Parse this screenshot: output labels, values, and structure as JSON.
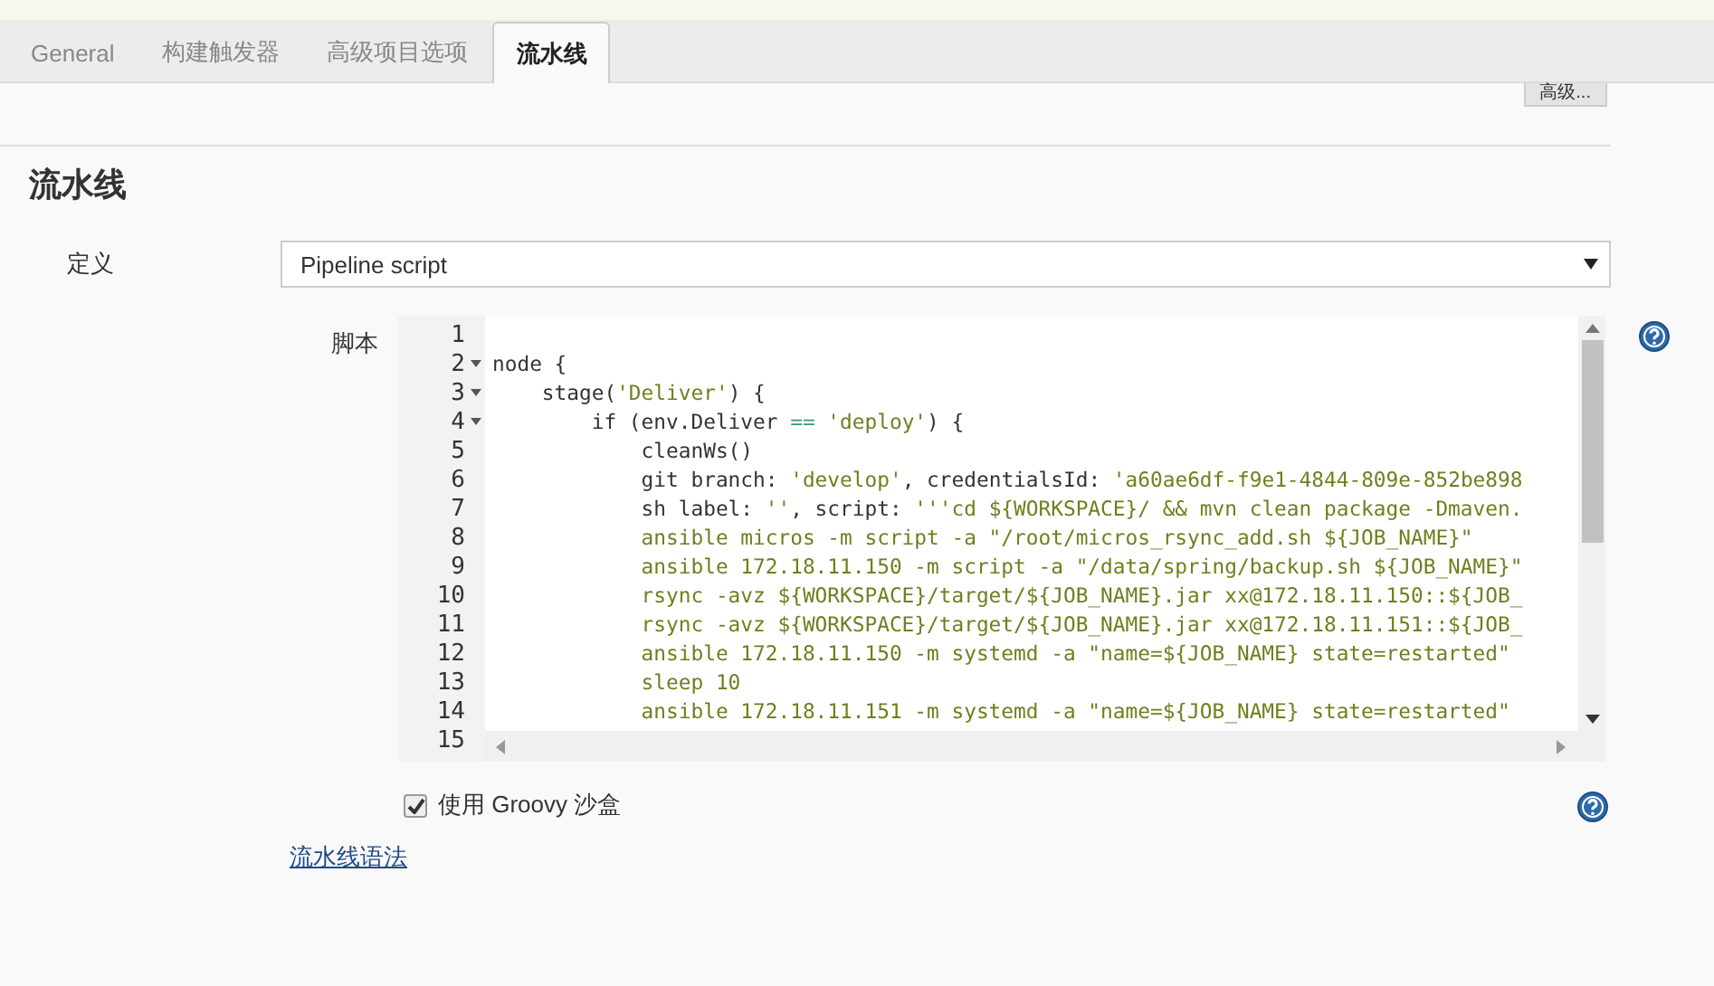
{
  "tabs": [
    {
      "label": "General",
      "selected": false
    },
    {
      "label": "构建触发器",
      "selected": false
    },
    {
      "label": "高级项目选项",
      "selected": false
    },
    {
      "label": "流水线",
      "selected": true
    }
  ],
  "advanced_button": "高级...",
  "section_title": "流水线",
  "definition": {
    "label": "定义",
    "value": "Pipeline script"
  },
  "script": {
    "label": "脚本",
    "lines": [
      {
        "number": "1",
        "foldable": false
      },
      {
        "number": "2",
        "foldable": true,
        "segments": [
          {
            "text": "node {",
            "kind": "plain"
          }
        ]
      },
      {
        "number": "3",
        "foldable": true,
        "segments": [
          {
            "text": "    stage(",
            "kind": "plain"
          },
          {
            "text": "'Deliver'",
            "kind": "string"
          },
          {
            "text": ") {",
            "kind": "plain"
          }
        ]
      },
      {
        "number": "4",
        "foldable": true,
        "segments": [
          {
            "text": "        if (env.Deliver ",
            "kind": "plain"
          },
          {
            "text": "==",
            "kind": "operator"
          },
          {
            "text": " 'deploy'",
            "kind": "string"
          },
          {
            "text": ") {",
            "kind": "plain"
          }
        ]
      },
      {
        "number": "5",
        "foldable": false,
        "segments": [
          {
            "text": "            cleanWs()",
            "kind": "plain"
          }
        ]
      },
      {
        "number": "6",
        "foldable": false,
        "segments": [
          {
            "text": "            git branch: ",
            "kind": "plain"
          },
          {
            "text": "'develop'",
            "kind": "string"
          },
          {
            "text": ", credentialsId: ",
            "kind": "plain"
          },
          {
            "text": "'a60ae6df-f9e1-4844-809e-852be898",
            "kind": "string"
          }
        ]
      },
      {
        "number": "7",
        "foldable": false,
        "segments": [
          {
            "text": "            sh label: ",
            "kind": "plain"
          },
          {
            "text": "''",
            "kind": "string"
          },
          {
            "text": ", script: ",
            "kind": "plain"
          },
          {
            "text": "'''cd ${WORKSPACE}/ && mvn clean package -Dmaven.",
            "kind": "string"
          }
        ]
      },
      {
        "number": "8",
        "foldable": false,
        "segments": [
          {
            "text": "            ansible micros -m script -a \"/root/micros_rsync_add.sh ${JOB_NAME}\"",
            "kind": "string"
          }
        ]
      },
      {
        "number": "9",
        "foldable": false,
        "segments": [
          {
            "text": "            ansible 172.18.11.150 -m script -a \"/data/spring/backup.sh ${JOB_NAME}\"",
            "kind": "string"
          }
        ]
      },
      {
        "number": "10",
        "foldable": false,
        "segments": [
          {
            "text": "            rsync -avz ${WORKSPACE}/target/${JOB_NAME}.jar xx@172.18.11.150::${JOB_",
            "kind": "string"
          }
        ]
      },
      {
        "number": "11",
        "foldable": false,
        "segments": [
          {
            "text": "            rsync -avz ${WORKSPACE}/target/${JOB_NAME}.jar xx@172.18.11.151::${JOB_",
            "kind": "string"
          }
        ]
      },
      {
        "number": "12",
        "foldable": false,
        "segments": [
          {
            "text": "            ansible 172.18.11.150 -m systemd -a \"name=${JOB_NAME} state=restarted\"",
            "kind": "string"
          }
        ]
      },
      {
        "number": "13",
        "foldable": false,
        "segments": [
          {
            "text": "            sleep 10",
            "kind": "string"
          }
        ]
      },
      {
        "number": "14",
        "foldable": false,
        "segments": [
          {
            "text": "            ansible 172.18.11.151 -m systemd -a \"name=${JOB_NAME} state=restarted\"",
            "kind": "string"
          }
        ]
      },
      {
        "number": "15",
        "foldable": false
      }
    ]
  },
  "sandbox": {
    "label": "使用 Groovy 沙盒",
    "checked": true
  },
  "syntax_link": "流水线语法"
}
